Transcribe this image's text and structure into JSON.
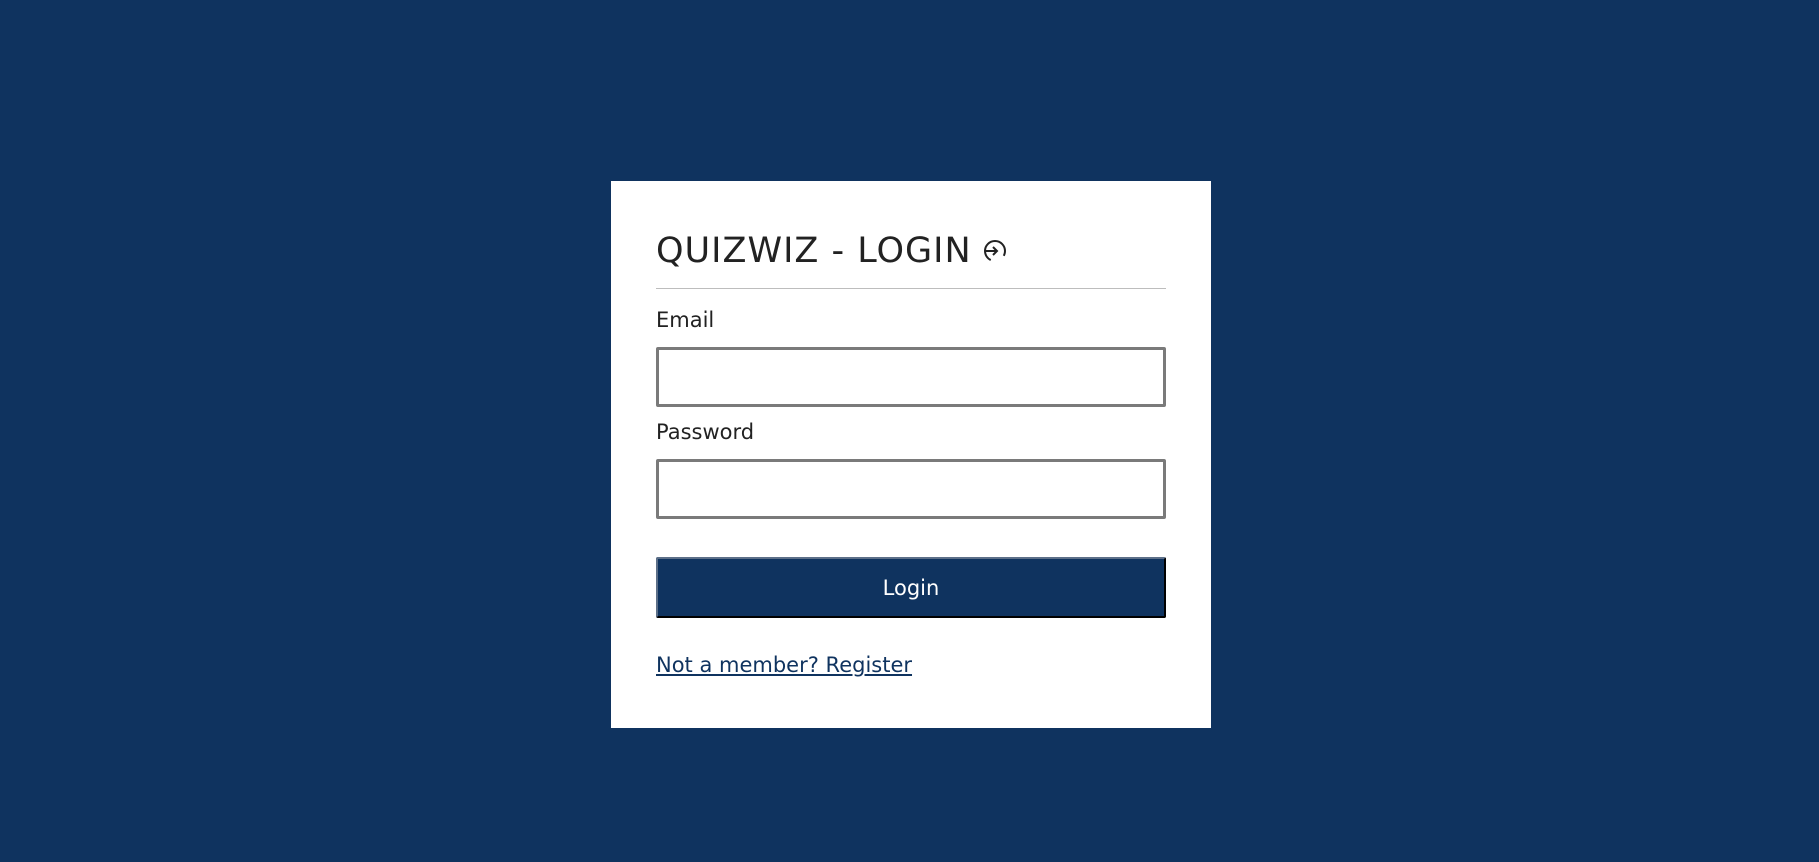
{
  "login_card": {
    "title": "QUIZWIZ - LOGIN",
    "title_icon": "login-icon",
    "email_label": "Email",
    "email_value": "",
    "password_label": "Password",
    "password_value": "",
    "login_button_label": "Login",
    "register_link_text": "Not a member? Register"
  },
  "colors": {
    "background": "#0f335f",
    "card": "#ffffff",
    "button": "#0f335f",
    "button_text": "#ffffff",
    "link": "#0f335f"
  }
}
